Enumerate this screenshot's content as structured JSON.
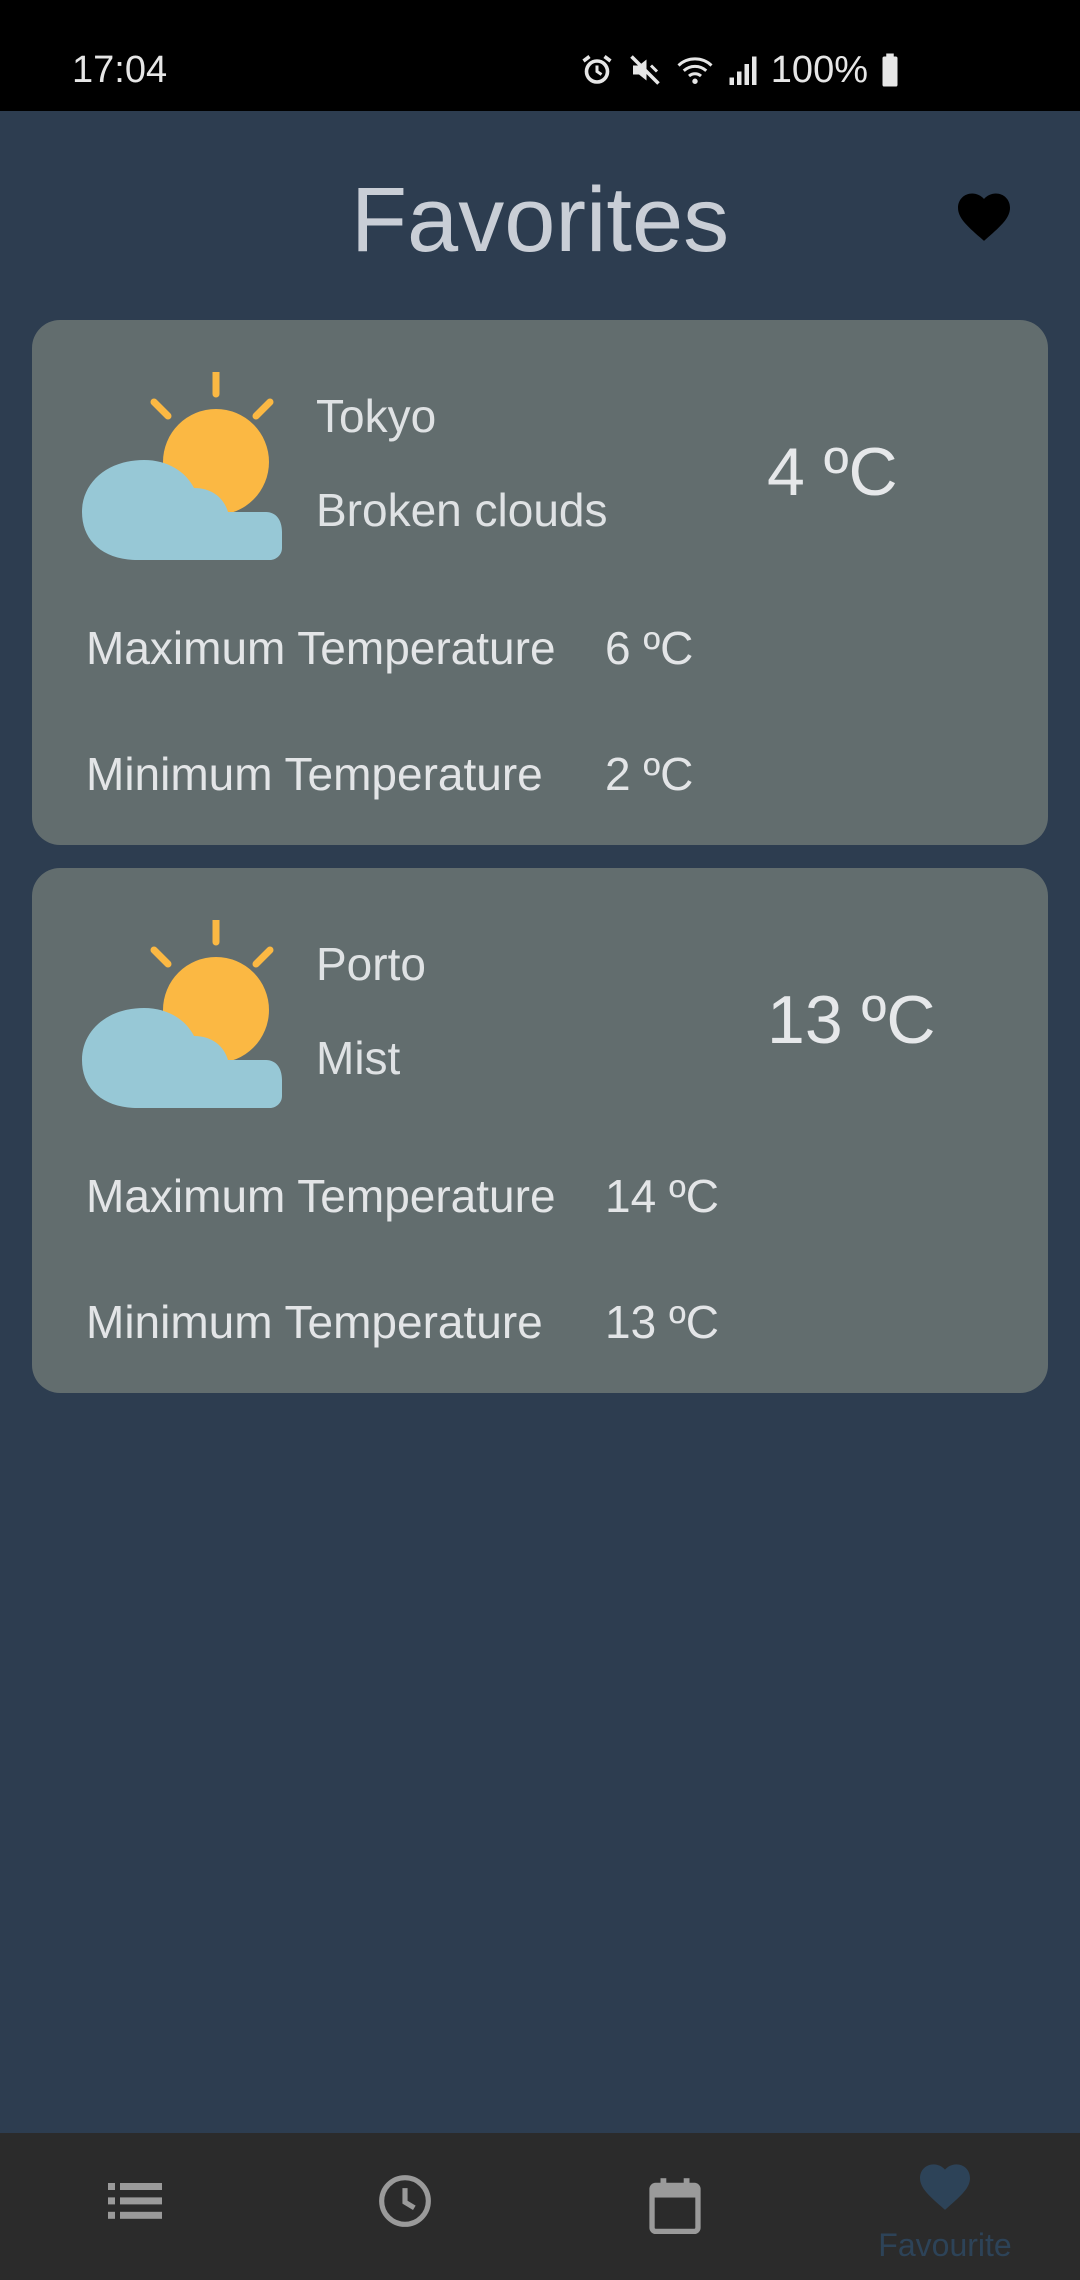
{
  "status_bar": {
    "time": "17:04",
    "battery_percent": "100%",
    "icons": [
      "alarm-icon",
      "mute-icon",
      "wifi-icon",
      "signal-icon",
      "battery-icon"
    ]
  },
  "header": {
    "title": "Favorites",
    "icon": "heart-icon"
  },
  "favorites": [
    {
      "city": "Tokyo",
      "condition": "Broken clouds",
      "current_temp": "4 ºC",
      "max_label": "Maximum Temperature",
      "max_value": "6 ºC",
      "min_label": "Minimum Temperature",
      "min_value": "2 ºC",
      "icon": "partly-cloudy-icon"
    },
    {
      "city": "Porto",
      "condition": "Mist",
      "current_temp": "13 ºC",
      "max_label": "Maximum Temperature",
      "max_value": "14 ºC",
      "min_label": "Minimum Temperature",
      "min_value": "13 ºC",
      "icon": "partly-cloudy-icon"
    }
  ],
  "bottom_nav": {
    "items": [
      {
        "icon": "list-icon",
        "label": "",
        "active": false
      },
      {
        "icon": "clock-icon",
        "label": "",
        "active": false
      },
      {
        "icon": "calendar-icon",
        "label": "",
        "active": false
      },
      {
        "icon": "heart-icon",
        "label": "Favourite",
        "active": true
      }
    ]
  },
  "colors": {
    "background": "#2d3d50",
    "card": "#626d6e",
    "sun": "#fbb843",
    "cloud": "#97c8d6",
    "nav_background": "#2b2b2b",
    "nav_active": "#2d4358"
  }
}
